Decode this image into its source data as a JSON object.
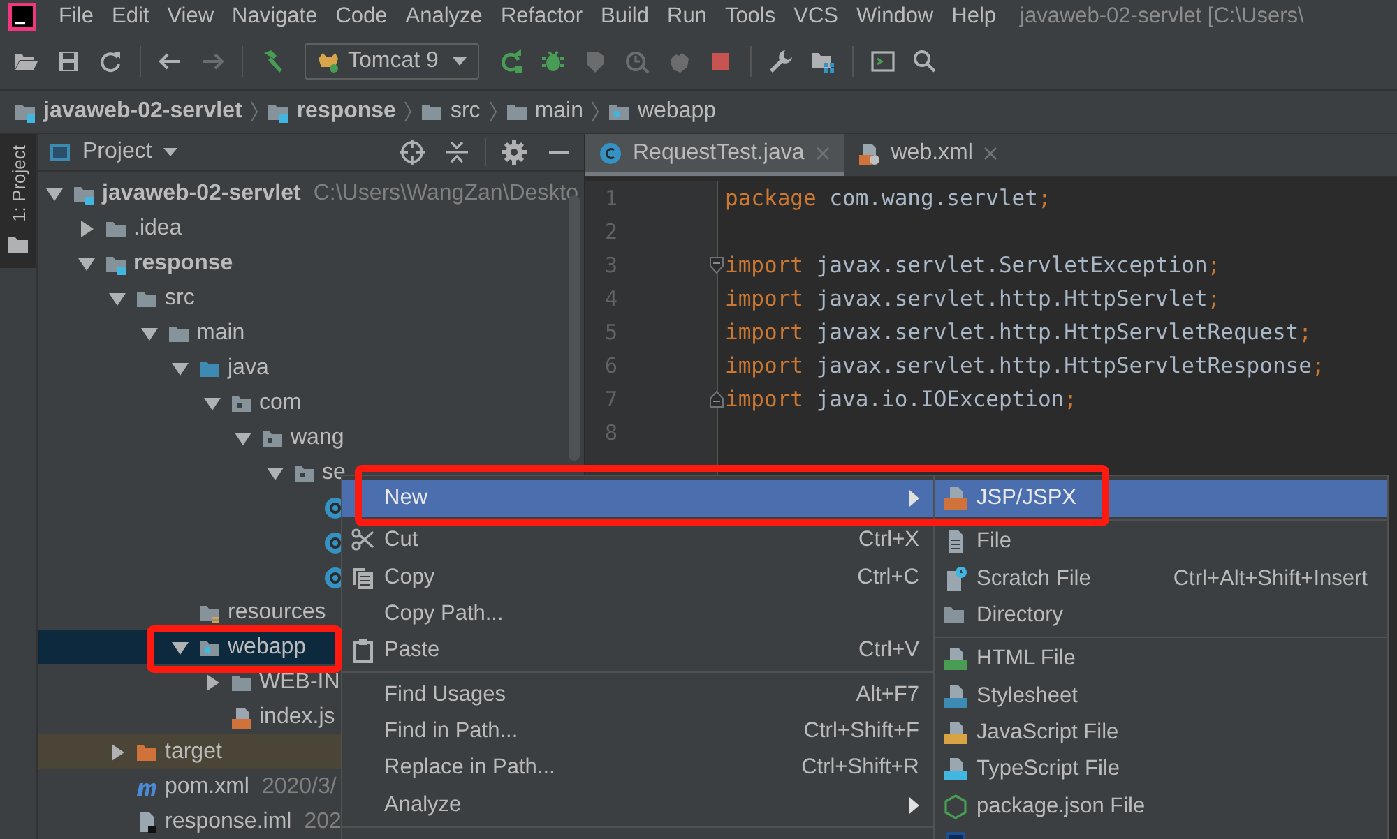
{
  "menu_bar": {
    "items": [
      {
        "label": "File"
      },
      {
        "label": "Edit"
      },
      {
        "label": "View"
      },
      {
        "label": "Navigate"
      },
      {
        "label": "Code"
      },
      {
        "label": "Analyze"
      },
      {
        "label": "Refactor"
      },
      {
        "label": "Build"
      },
      {
        "label": "Run"
      },
      {
        "label": "Tools"
      },
      {
        "label": "VCS"
      },
      {
        "label": "Window"
      },
      {
        "label": "Help"
      }
    ],
    "title": "javaweb-02-servlet [C:\\Users\\"
  },
  "toolbar": {
    "items": [
      {
        "kind": "open",
        "disabled": false
      },
      {
        "kind": "save",
        "disabled": false
      },
      {
        "kind": "sync",
        "disabled": false
      },
      {
        "kind": "separator"
      },
      {
        "kind": "back",
        "disabled": false
      },
      {
        "kind": "forward",
        "disabled": true
      },
      {
        "kind": "separator"
      },
      {
        "kind": "build",
        "disabled": false
      },
      {
        "kind": "run-config",
        "label": "Tomcat 9"
      },
      {
        "kind": "rerun",
        "disabled": false
      },
      {
        "kind": "debug",
        "disabled": false
      },
      {
        "kind": "coverage",
        "disabled": true
      },
      {
        "kind": "profile",
        "disabled": true
      },
      {
        "kind": "attach",
        "disabled": true
      },
      {
        "kind": "stop",
        "disabled": false
      },
      {
        "kind": "separator"
      },
      {
        "kind": "wrench",
        "disabled": false
      },
      {
        "kind": "structure",
        "disabled": false
      },
      {
        "kind": "separator"
      },
      {
        "kind": "terminal",
        "disabled": false
      },
      {
        "kind": "search",
        "disabled": false
      }
    ]
  },
  "breadcrumbs": [
    {
      "label": "javaweb-02-servlet",
      "kind": "module"
    },
    {
      "label": "response",
      "kind": "module"
    },
    {
      "label": "src",
      "kind": "folder"
    },
    {
      "label": "main",
      "kind": "folder"
    },
    {
      "label": "webapp",
      "kind": "web-root"
    }
  ],
  "project_panel": {
    "title": "Project",
    "tree": [
      {
        "label": "javaweb-02-servlet",
        "hint": "C:\\Users\\WangZan\\Deskto",
        "kind": "module",
        "expanded": true,
        "selected": false,
        "children": [
          {
            "label": ".idea",
            "kind": "folder",
            "expanded": false,
            "selected": false
          },
          {
            "label": "response",
            "kind": "module",
            "expanded": true,
            "selected": false,
            "children": [
              {
                "label": "src",
                "kind": "folder",
                "expanded": true,
                "selected": false,
                "children": [
                  {
                    "label": "main",
                    "kind": "folder",
                    "expanded": true,
                    "selected": false,
                    "children": [
                      {
                        "label": "java",
                        "kind": "source-root",
                        "expanded": true,
                        "selected": false,
                        "children": [
                          {
                            "label": "com",
                            "kind": "package",
                            "expanded": true,
                            "selected": false,
                            "children": [
                              {
                                "label": "wang",
                                "kind": "package",
                                "expanded": true,
                                "selected": false,
                                "children": [
                                  {
                                    "label": "se",
                                    "kind": "package",
                                    "expanded": true,
                                    "selected": false,
                                    "children": [
                                      {
                                        "kind": "class",
                                        "selected": false
                                      },
                                      {
                                        "kind": "class",
                                        "selected": false
                                      },
                                      {
                                        "kind": "class",
                                        "selected": false
                                      }
                                    ]
                                  }
                                ]
                              }
                            ]
                          }
                        ]
                      },
                      {
                        "label": "resources",
                        "kind": "resource-root",
                        "selected": false
                      },
                      {
                        "label": "webapp",
                        "kind": "web-root",
                        "expanded": true,
                        "selected": true,
                        "children": [
                          {
                            "label": "WEB-IN",
                            "kind": "folder",
                            "expanded": false,
                            "selected": false
                          },
                          {
                            "label": "index.js",
                            "kind": "jsp",
                            "selected": false
                          }
                        ]
                      }
                    ]
                  }
                ]
              },
              {
                "label": "target",
                "kind": "excluded",
                "expanded": false,
                "selected": false
              },
              {
                "label": "pom.xml",
                "hint": "2020/3/",
                "kind": "maven",
                "selected": false
              },
              {
                "label": "response.iml",
                "hint": "202",
                "kind": "iml",
                "selected": false
              }
            ]
          }
        ]
      }
    ]
  },
  "side_strip": {
    "tab": "1: Project"
  },
  "editor": {
    "tabs": [
      {
        "label": "RequestTest.java",
        "kind": "java",
        "selected": true
      },
      {
        "label": "web.xml",
        "kind": "xml",
        "selected": false
      }
    ],
    "lines": [
      {
        "number": "1",
        "kind": "code",
        "tokens": [
          {
            "kind": "keyword",
            "text": "package"
          },
          {
            "kind": "plain",
            "text": " com.wang.servlet"
          },
          {
            "kind": "keyword",
            "text": ";"
          }
        ]
      },
      {
        "number": "2",
        "kind": "code"
      },
      {
        "number": "3",
        "kind": "fold-start",
        "tokens": [
          {
            "kind": "keyword",
            "text": "import"
          },
          {
            "kind": "plain",
            "text": " javax.servlet.ServletException"
          },
          {
            "kind": "keyword",
            "text": ";"
          }
        ]
      },
      {
        "number": "4",
        "kind": "code",
        "tokens": [
          {
            "kind": "keyword",
            "text": "import"
          },
          {
            "kind": "plain",
            "text": " javax.servlet.http.HttpServlet"
          },
          {
            "kind": "keyword",
            "text": ";"
          }
        ]
      },
      {
        "number": "5",
        "kind": "code",
        "tokens": [
          {
            "kind": "keyword",
            "text": "import"
          },
          {
            "kind": "plain",
            "text": " javax.servlet.http.HttpServletRequest"
          },
          {
            "kind": "keyword",
            "text": ";"
          }
        ]
      },
      {
        "number": "6",
        "kind": "code",
        "tokens": [
          {
            "kind": "keyword",
            "text": "import"
          },
          {
            "kind": "plain",
            "text": " javax.servlet.http.HttpServletResponse"
          },
          {
            "kind": "keyword",
            "text": ";"
          }
        ]
      },
      {
        "number": "7",
        "kind": "fold-end",
        "tokens": [
          {
            "kind": "keyword",
            "text": "import"
          },
          {
            "kind": "plain",
            "text": " java.io.IOException"
          },
          {
            "kind": "keyword",
            "text": ";"
          }
        ]
      },
      {
        "number": "8",
        "kind": "code"
      }
    ]
  },
  "context_menu": {
    "items": [
      {
        "kind": "item",
        "label": "New",
        "submenu": true,
        "selected": true
      },
      {
        "kind": "cut",
        "label": "Cut",
        "shortcut": "Ctrl+X",
        "selected": false
      },
      {
        "kind": "copy",
        "label": "Copy",
        "shortcut": "Ctrl+C",
        "selected": false
      },
      {
        "kind": "item",
        "label": "Copy Path...",
        "selected": false
      },
      {
        "kind": "paste",
        "label": "Paste",
        "shortcut": "Ctrl+V",
        "selected": false
      },
      {
        "kind": "separator"
      },
      {
        "kind": "item",
        "label": "Find Usages",
        "shortcut": "Alt+F7",
        "selected": false
      },
      {
        "kind": "item",
        "label": "Find in Path...",
        "shortcut": "Ctrl+Shift+F",
        "selected": false
      },
      {
        "kind": "item",
        "label": "Replace in Path...",
        "shortcut": "Ctrl+Shift+R",
        "selected": false
      },
      {
        "kind": "item",
        "label": "Analyze",
        "submenu": true,
        "selected": false
      },
      {
        "kind": "separator"
      }
    ]
  },
  "new_submenu": {
    "items": [
      {
        "kind": "jsp",
        "label": "JSP/JSPX",
        "selected": true
      },
      {
        "kind": "separator"
      },
      {
        "kind": "file",
        "label": "File",
        "selected": false
      },
      {
        "kind": "scratch",
        "label": "Scratch File",
        "shortcut": "Ctrl+Alt+Shift+Insert",
        "selected": false
      },
      {
        "kind": "directory",
        "label": "Directory",
        "selected": false
      },
      {
        "kind": "separator"
      },
      {
        "kind": "html",
        "label": "HTML File",
        "selected": false
      },
      {
        "kind": "css",
        "label": "Stylesheet",
        "selected": false
      },
      {
        "kind": "js",
        "label": "JavaScript File",
        "selected": false
      },
      {
        "kind": "ts",
        "label": "TypeScript File",
        "selected": false
      },
      {
        "kind": "node",
        "label": "package.json File",
        "selected": false
      },
      {
        "kind": "cfml",
        "selected": false
      }
    ]
  }
}
